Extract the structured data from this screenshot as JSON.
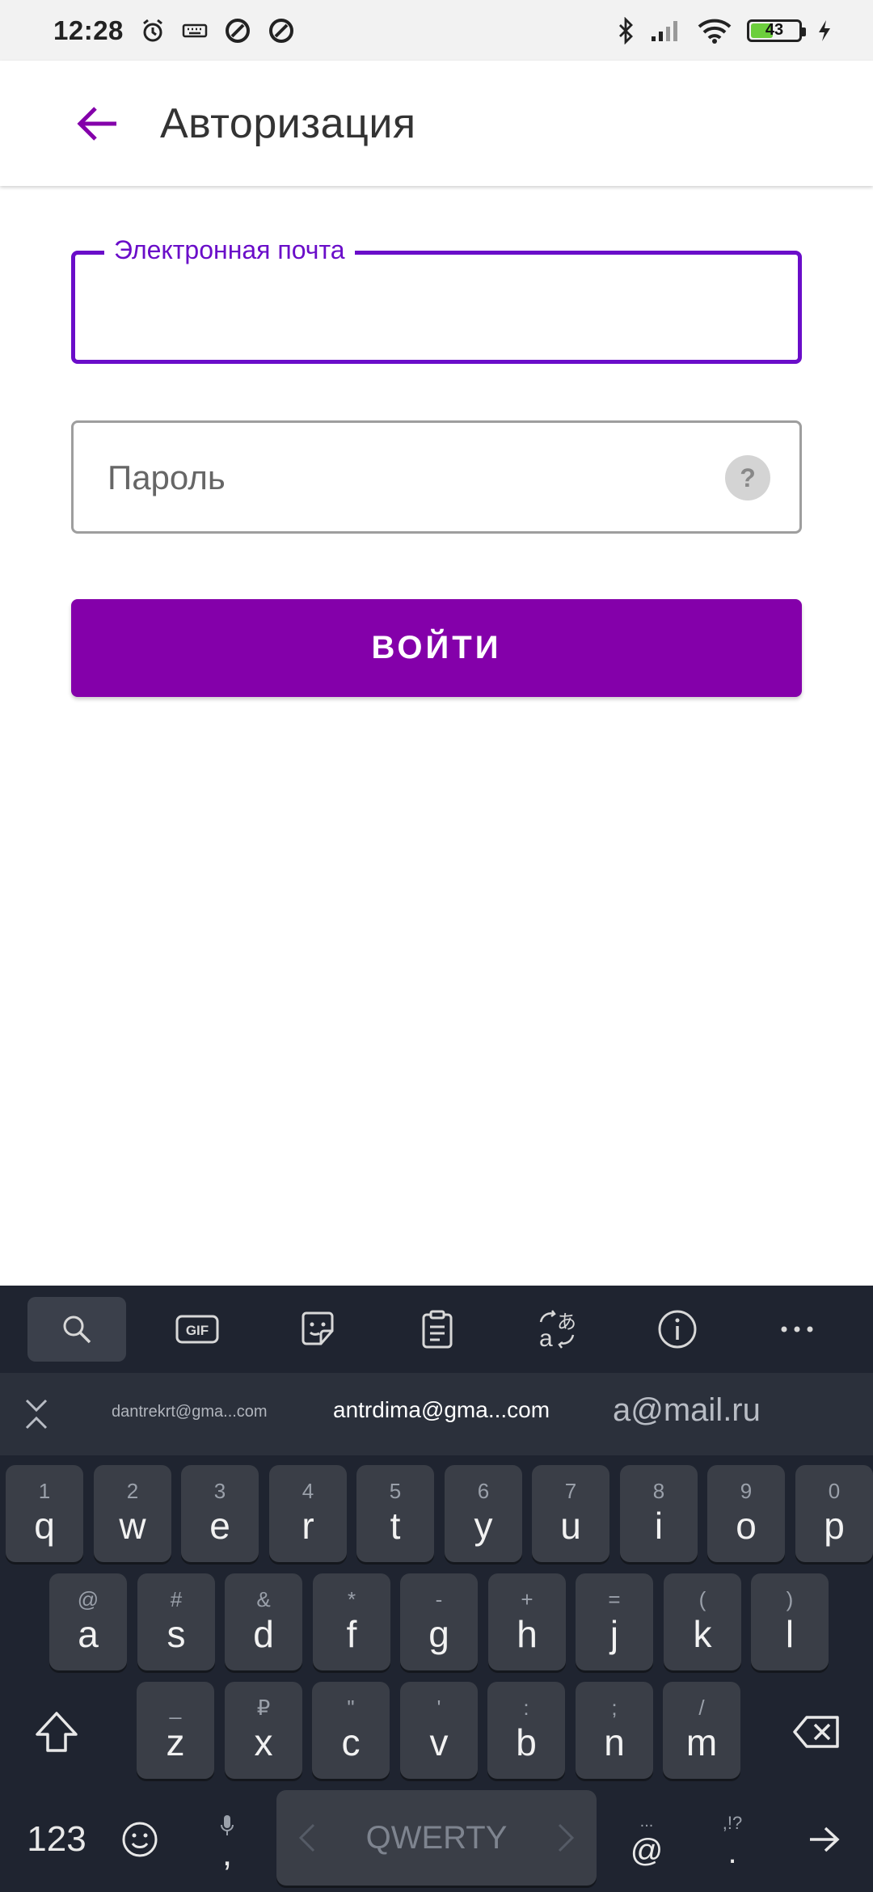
{
  "status_bar": {
    "time": "12:28",
    "battery_level": "43"
  },
  "app_bar": {
    "title": "Авторизация"
  },
  "form": {
    "email_label": "Электронная почта",
    "email_value": "",
    "password_placeholder": "Пароль",
    "help_symbol": "?",
    "login_button": "ВОЙТИ"
  },
  "keyboard": {
    "suggestions": [
      "dantrekrt@gma...com",
      "antrdima@gma...com",
      "a@mail.ru"
    ],
    "row1": [
      {
        "main": "q",
        "alt": "1"
      },
      {
        "main": "w",
        "alt": "2"
      },
      {
        "main": "e",
        "alt": "3"
      },
      {
        "main": "r",
        "alt": "4"
      },
      {
        "main": "t",
        "alt": "5"
      },
      {
        "main": "y",
        "alt": "6"
      },
      {
        "main": "u",
        "alt": "7"
      },
      {
        "main": "i",
        "alt": "8"
      },
      {
        "main": "o",
        "alt": "9"
      },
      {
        "main": "p",
        "alt": "0"
      }
    ],
    "row2": [
      {
        "main": "a",
        "alt": "@"
      },
      {
        "main": "s",
        "alt": "#"
      },
      {
        "main": "d",
        "alt": "&"
      },
      {
        "main": "f",
        "alt": "*"
      },
      {
        "main": "g",
        "alt": "-"
      },
      {
        "main": "h",
        "alt": "+"
      },
      {
        "main": "j",
        "alt": "="
      },
      {
        "main": "k",
        "alt": "("
      },
      {
        "main": "l",
        "alt": ")"
      }
    ],
    "row3": [
      {
        "main": "z",
        "alt": "_"
      },
      {
        "main": "x",
        "alt": "₽"
      },
      {
        "main": "c",
        "alt": "\""
      },
      {
        "main": "v",
        "alt": "'"
      },
      {
        "main": "b",
        "alt": ":"
      },
      {
        "main": "n",
        "alt": ";"
      },
      {
        "main": "m",
        "alt": "/"
      }
    ],
    "numbers_key": "123",
    "comma_key": ",",
    "space_label": "QWERTY",
    "at_key": "@",
    "at_alt": "...",
    "period_key": ".",
    "period_alt": ",!?"
  },
  "colors": {
    "accent": "#8400aa",
    "focus": "#6a0dc9",
    "keyboard_bg": "#1f2430"
  }
}
